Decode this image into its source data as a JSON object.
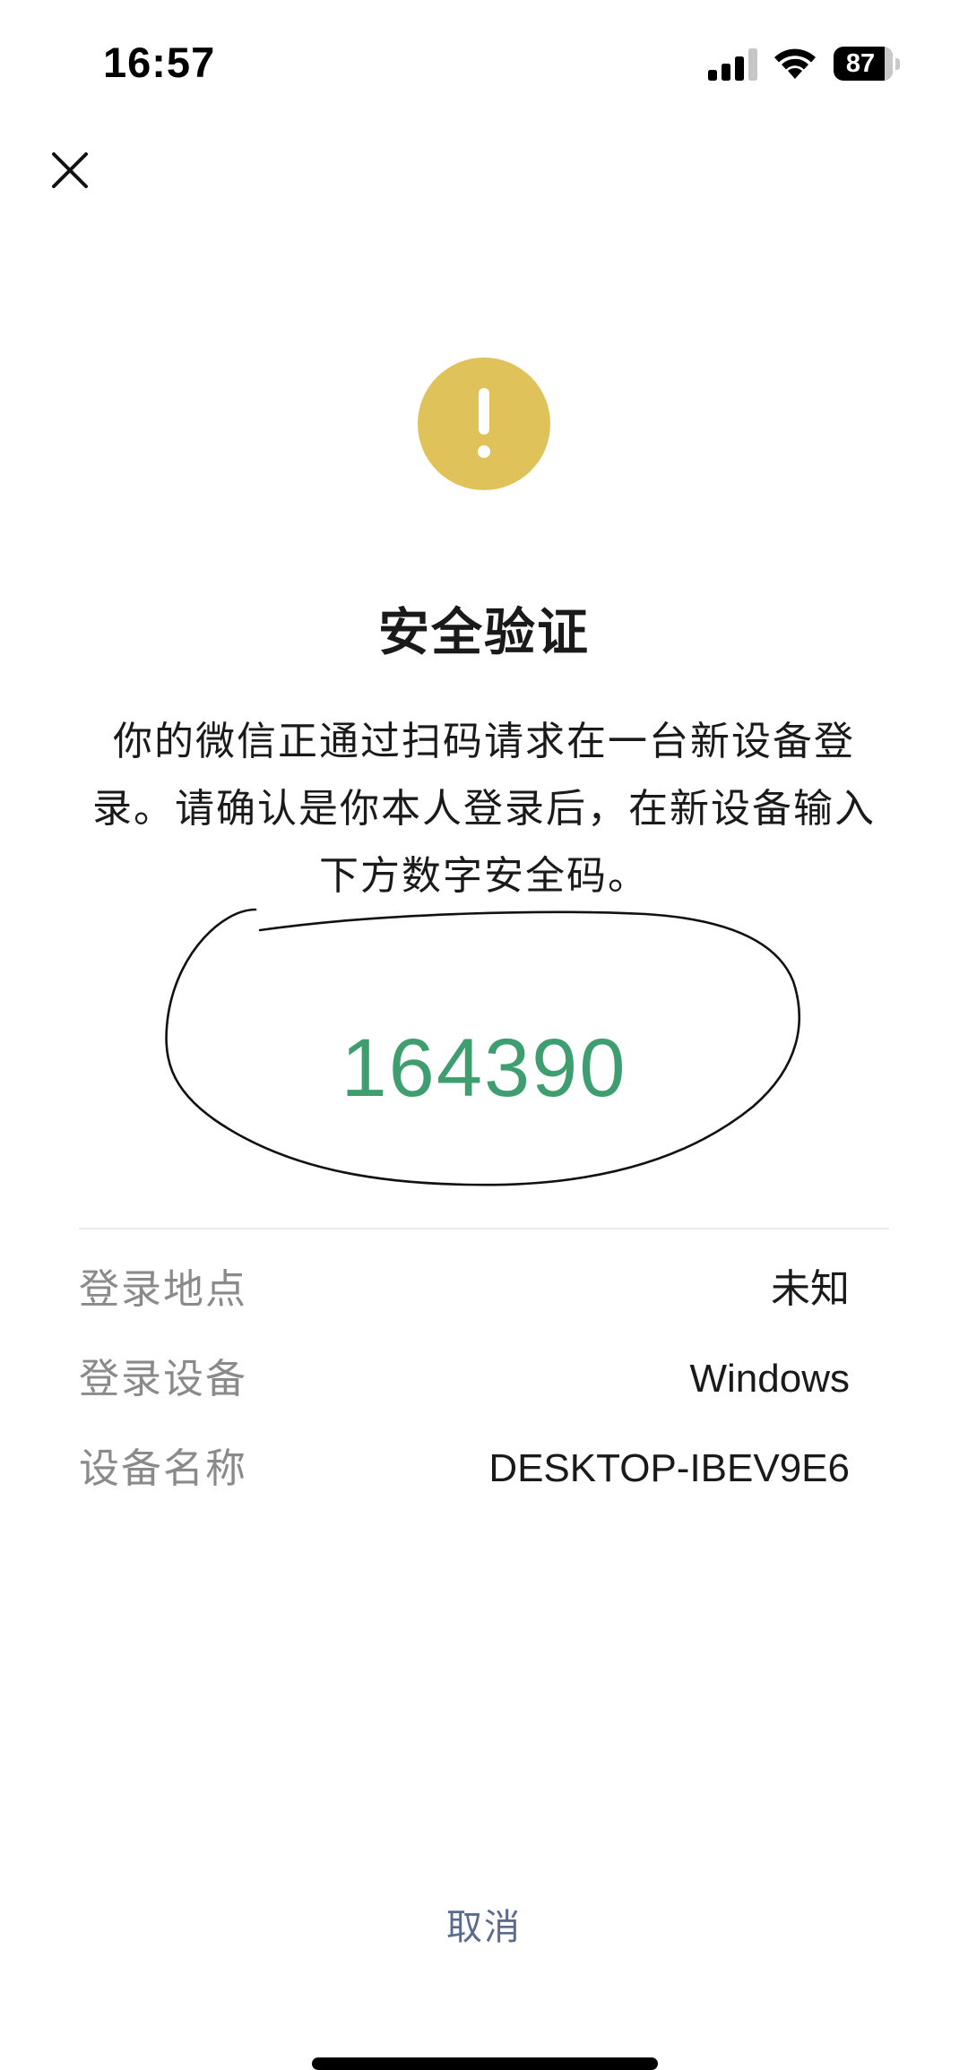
{
  "status_bar": {
    "time": "16:57",
    "battery_level": "87",
    "icons": [
      "cellular-signal-icon",
      "wifi-icon",
      "battery-icon"
    ]
  },
  "header": {
    "close_icon": "close-icon"
  },
  "warning": {
    "icon": "exclamation-icon",
    "color": "#e0c25b"
  },
  "title": "安全验证",
  "description": "你的微信正通过扫码请求在一台新设备登录。请确认是你本人登录后，在新设备输入下方数字安全码。",
  "security_code": {
    "value": "164390",
    "color": "#3f9e6f"
  },
  "info": [
    {
      "label": "登录地点",
      "value": "未知"
    },
    {
      "label": "登录设备",
      "value": "Windows"
    },
    {
      "label": "设备名称",
      "value": "DESKTOP-IBEV9E6"
    }
  ],
  "cancel_label": "取消",
  "colors": {
    "cancel_link": "#5b6b8c",
    "label_gray": "#8a8a8a"
  }
}
